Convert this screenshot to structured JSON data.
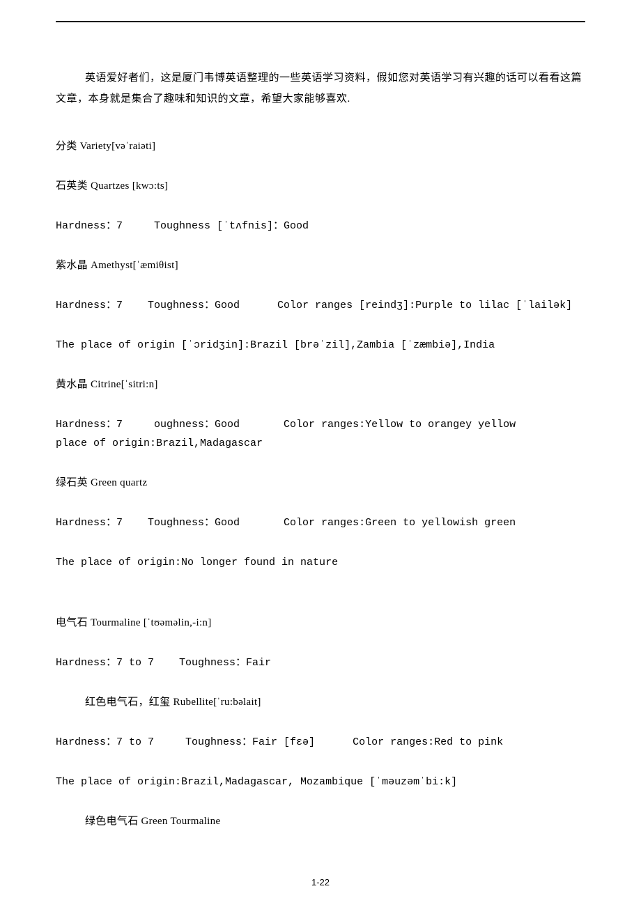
{
  "intro": "英语爱好者们，这是厦门韦博英语整理的一些英语学习资料，假如您对英语学习有兴趣的话可以看看这篇文章，本身就是集合了趣味和知识的文章，希望大家能够喜欢.",
  "lines": {
    "l1": "分类 Variety[vəˈraiəti]",
    "l2": "石英类 Quartzes [kwɔ:ts]",
    "l3": "Hardness：7     Toughness [ˈtʌfnis]：Good",
    "l4": "紫水晶 Amethyst[ˈæmiθist]",
    "l5": "Hardness：7    Toughness：Good      Color ranges [reindʒ]:Purple to lilac [ˈlailək]",
    "l6": "The place of origin [ˈɔridʒin]:Brazil [brəˈzil],Zambia [ˈzæmbiə],India",
    "l7": "黄水晶 Citrine[ˈsitri:n]",
    "l8": "Hardness：7     oughness：Good       Color ranges:Yellow to orangey yellow        place of origin:Brazil,Madagascar",
    "l9": "绿石英 Green quartz",
    "l10": "Hardness：7    Toughness：Good       Color ranges:Green to yellowish green",
    "l11": "The place of origin:No longer found in nature",
    "l12": "电气石 Tourmaline [ˈtʊəməlin,-i:n]",
    "l13": "Hardness：7 to 7    Toughness：Fair",
    "l14": "红色电气石，红玺 Rubellite[ˈru:bəlait]",
    "l15": "Hardness：7 to 7     Toughness：Fair [fεə]      Color ranges:Red to pink",
    "l16": "The place of origin:Brazil,Madagascar, Mozambique [ˈməuzəmˈbi:k]",
    "l17": "绿色电气石 Green Tourmaline"
  },
  "page_number": "1-22"
}
